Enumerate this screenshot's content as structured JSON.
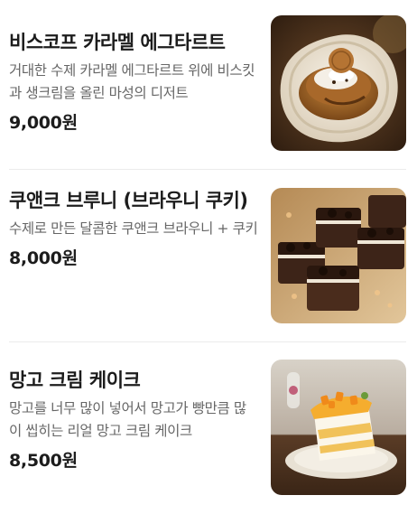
{
  "menu": {
    "items": [
      {
        "name": "비스코프 카라멜 에그타르트",
        "description": "거대한 수제 카라멜 에그타르트 위에 비스킷과 생크림을 올린 마성의 디저트",
        "price": "9,000원",
        "image_icon": "caramel-egg-tart-photo"
      },
      {
        "name": "쿠앤크 브루니 (브라우니 쿠키)",
        "description": "수제로 만든 달콤한 쿠앤크 브라우니 + 쿠키",
        "price": "8,000원",
        "image_icon": "cookies-and-cream-brownie-photo"
      },
      {
        "name": "망고 크림 케이크",
        "description": "망고를 너무 많이 넣어서 망고가 빵만큼 많이 씹히는 리얼 망고 크림 케이크",
        "price": "8,500원",
        "image_icon": "mango-cream-cake-photo"
      }
    ]
  }
}
